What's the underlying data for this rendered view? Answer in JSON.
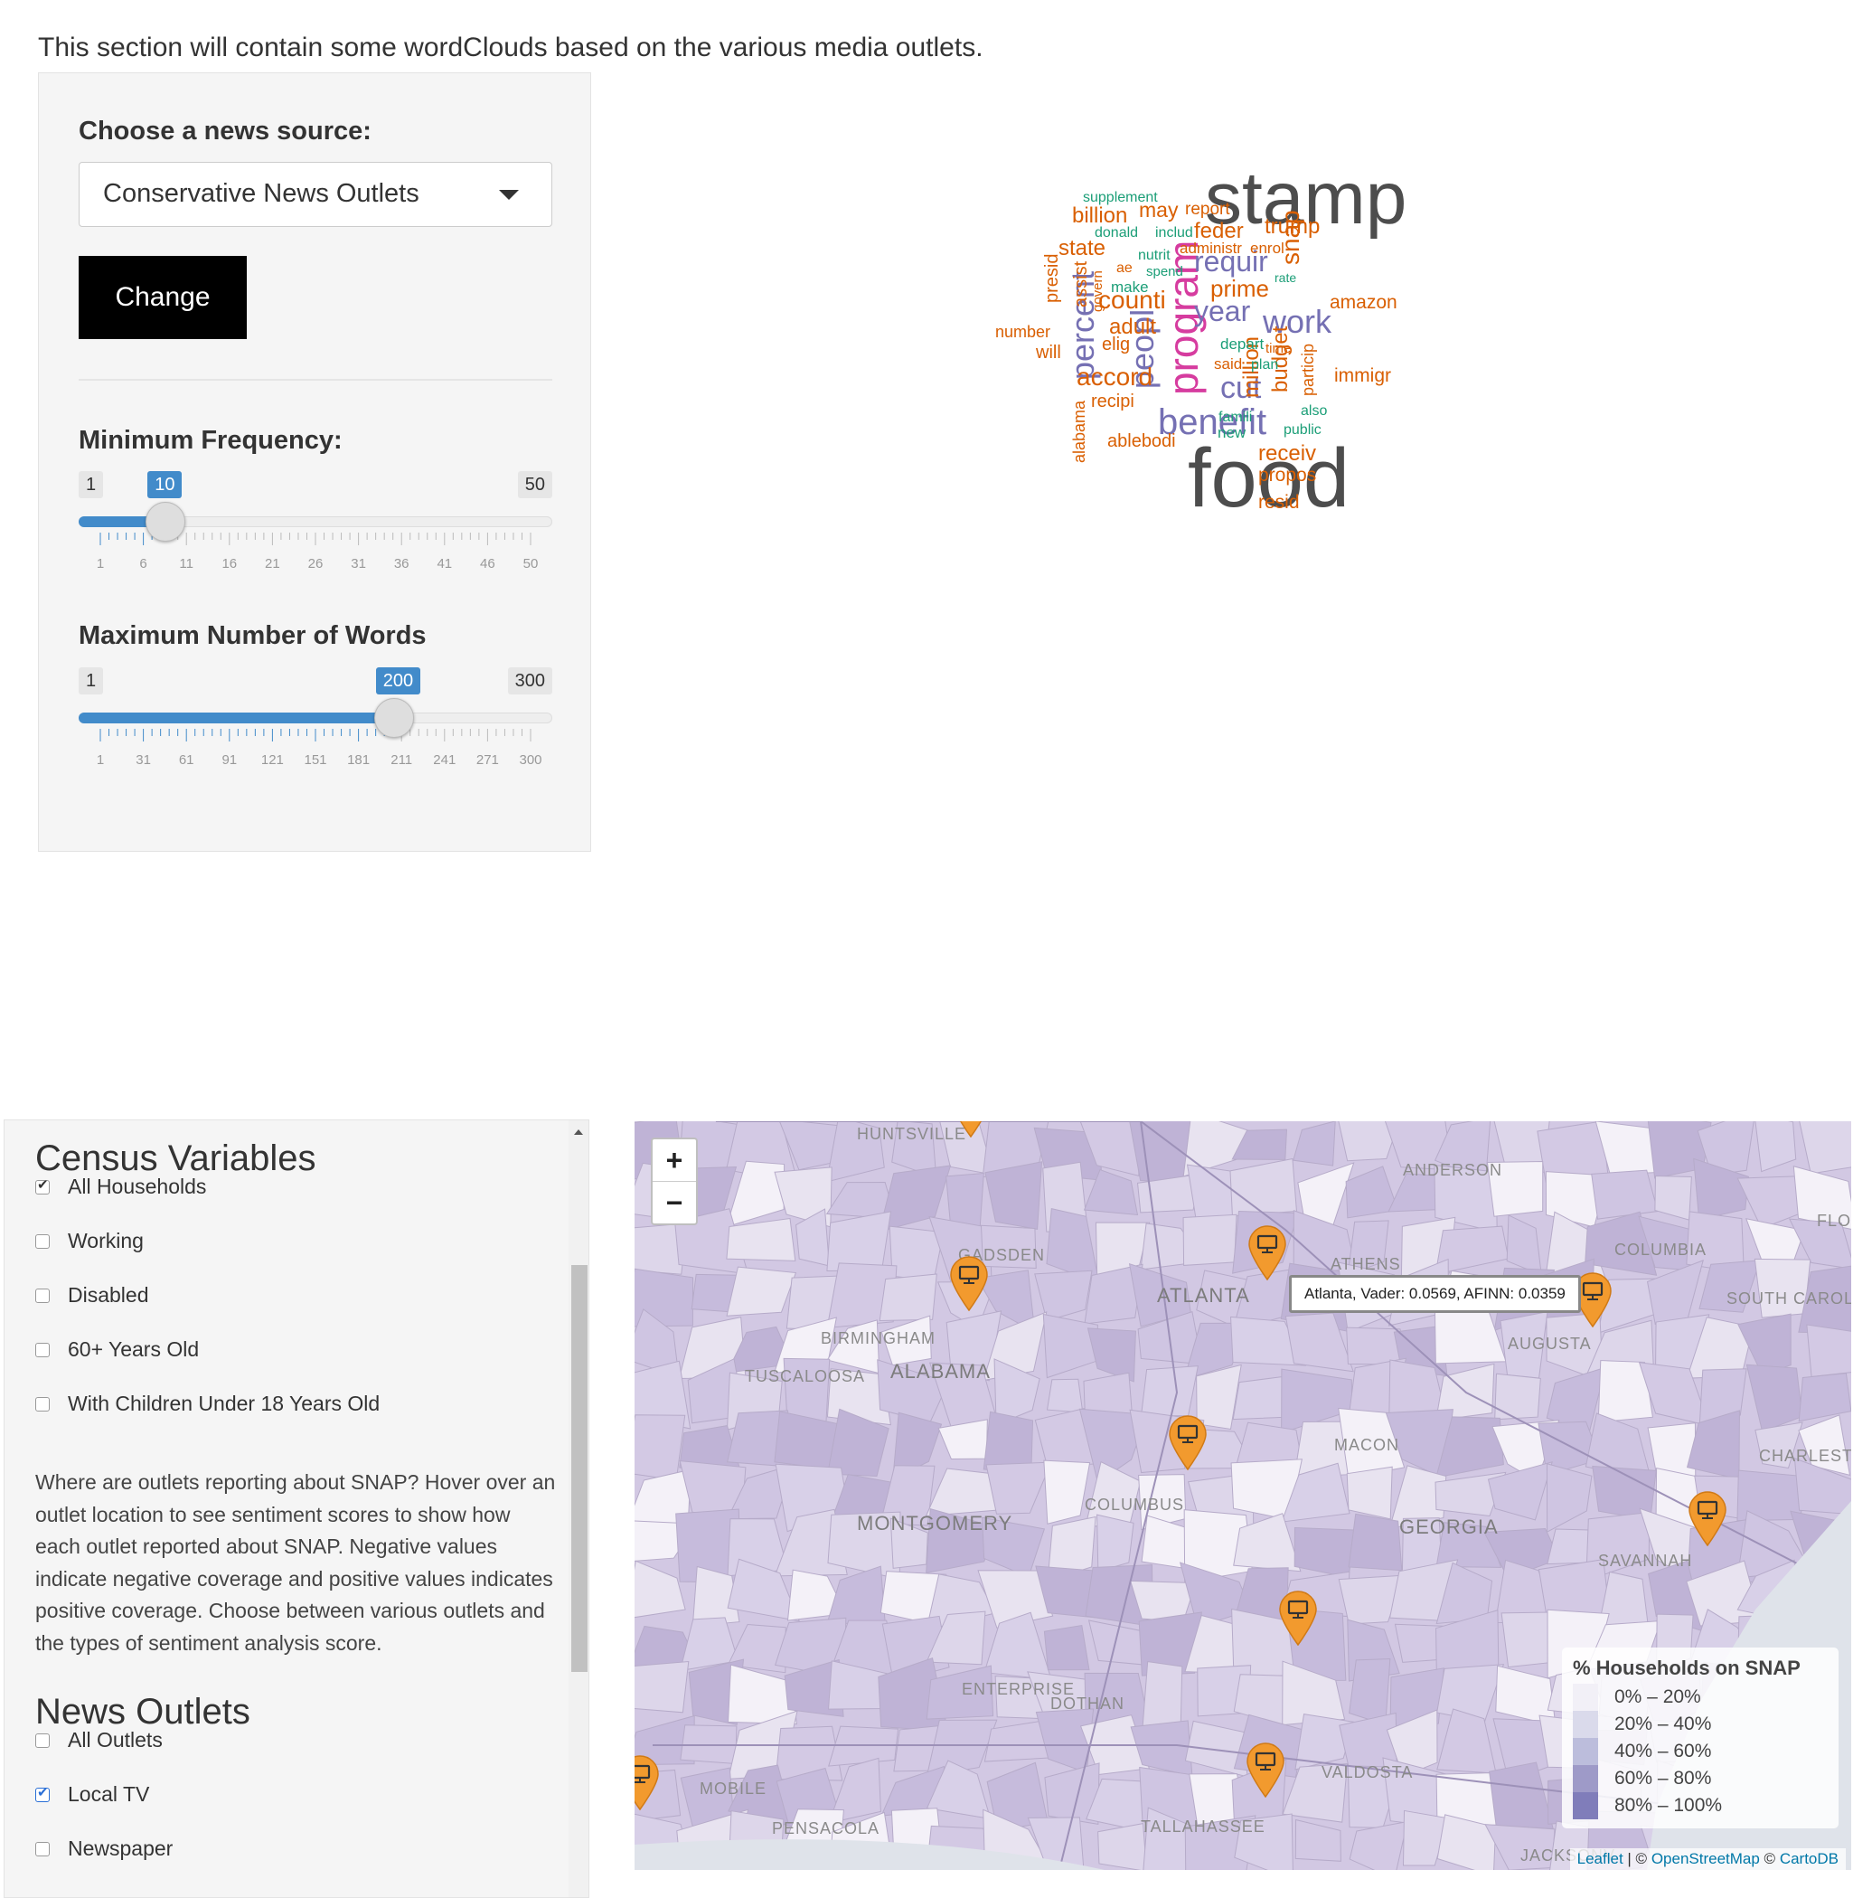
{
  "intro": "This section will contain some wordClouds based on the various media outlets.",
  "wordcloud_panel": {
    "source_label": "Choose a news source:",
    "source_value": "Conservative News Outlets",
    "change_button": "Change",
    "min_freq": {
      "label": "Minimum Frequency:",
      "min": "1",
      "max": "50",
      "value": "10",
      "value_num": 10,
      "range": [
        1,
        50
      ],
      "grid": [
        "1",
        "6",
        "11",
        "16",
        "21",
        "26",
        "31",
        "36",
        "41",
        "46",
        "50"
      ]
    },
    "max_words": {
      "label": "Maximum Number of Words",
      "min": "1",
      "max": "300",
      "value": "200",
      "value_num": 200,
      "range": [
        1,
        300
      ],
      "grid": [
        "1",
        "31",
        "61",
        "91",
        "121",
        "151",
        "181",
        "211",
        "241",
        "271",
        "300"
      ]
    }
  },
  "wordcloud": {
    "words": [
      {
        "text": "stamp",
        "color": "#4d4d4d"
      },
      {
        "text": "food",
        "color": "#4d4d4d"
      },
      {
        "text": "program",
        "color": "#d63c9f"
      },
      {
        "text": "benefit",
        "color": "#7570b3"
      },
      {
        "text": "percent",
        "color": "#7570b3"
      },
      {
        "text": "peopl",
        "color": "#7570b3"
      },
      {
        "text": "work",
        "color": "#7570b3"
      },
      {
        "text": "year",
        "color": "#7570b3"
      },
      {
        "text": "cut",
        "color": "#7570b3"
      },
      {
        "text": "requir",
        "color": "#7570b3"
      },
      {
        "text": "snap",
        "color": "#d95f02"
      },
      {
        "text": "accord",
        "color": "#d95f02"
      },
      {
        "text": "counti",
        "color": "#d95f02"
      },
      {
        "text": "prime",
        "color": "#d95f02"
      },
      {
        "text": "adult",
        "color": "#d95f02"
      },
      {
        "text": "trump",
        "color": "#d95f02"
      },
      {
        "text": "feder",
        "color": "#d95f02"
      },
      {
        "text": "billion",
        "color": "#d95f02"
      },
      {
        "text": "state",
        "color": "#d95f02"
      },
      {
        "text": "may",
        "color": "#d95f02"
      },
      {
        "text": "report",
        "color": "#d95f02"
      },
      {
        "text": "amazon",
        "color": "#d95f02"
      },
      {
        "text": "immigr",
        "color": "#d95f02"
      },
      {
        "text": "million",
        "color": "#d95f02"
      },
      {
        "text": "budget",
        "color": "#d95f02"
      },
      {
        "text": "receiv",
        "color": "#d95f02"
      },
      {
        "text": "propos",
        "color": "#d95f02"
      },
      {
        "text": "resid",
        "color": "#d95f02"
      },
      {
        "text": "ablebodi",
        "color": "#d95f02"
      },
      {
        "text": "recipi",
        "color": "#d95f02"
      },
      {
        "text": "elig",
        "color": "#d95f02"
      },
      {
        "text": "will",
        "color": "#d95f02"
      },
      {
        "text": "number",
        "color": "#d95f02"
      },
      {
        "text": "presid",
        "color": "#d95f02"
      },
      {
        "text": "assist",
        "color": "#d95f02"
      },
      {
        "text": "alabama",
        "color": "#d95f02"
      },
      {
        "text": "particip",
        "color": "#d95f02"
      },
      {
        "text": "administr",
        "color": "#d95f02"
      },
      {
        "text": "enrol",
        "color": "#d95f02"
      },
      {
        "text": "said",
        "color": "#d95f02"
      },
      {
        "text": "supplement",
        "color": "#1b9e77"
      },
      {
        "text": "donald",
        "color": "#1b9e77"
      },
      {
        "text": "includ",
        "color": "#1b9e77"
      },
      {
        "text": "nutrit",
        "color": "#1b9e77"
      },
      {
        "text": "spend",
        "color": "#1b9e77"
      },
      {
        "text": "make",
        "color": "#1b9e77"
      },
      {
        "text": "depart",
        "color": "#1b9e77"
      },
      {
        "text": "time",
        "color": "#d95f02"
      },
      {
        "text": "plan",
        "color": "#1b9e77"
      },
      {
        "text": "also",
        "color": "#1b9e77"
      },
      {
        "text": "public",
        "color": "#1b9e77"
      },
      {
        "text": "famili",
        "color": "#1b9e77"
      },
      {
        "text": "new",
        "color": "#1b9e77"
      },
      {
        "text": "rate",
        "color": "#1b9e77"
      },
      {
        "text": "govern",
        "color": "#d95f02"
      },
      {
        "text": "ae",
        "color": "#d95f02"
      }
    ]
  },
  "census": {
    "title": "Census Variables",
    "vars": [
      {
        "label": "All Households",
        "checked": true
      },
      {
        "label": "Working",
        "checked": false
      },
      {
        "label": "Disabled",
        "checked": false
      },
      {
        "label": "60+ Years Old",
        "checked": false
      },
      {
        "label": "With Children Under 18 Years Old",
        "checked": false
      }
    ],
    "description": "Where are outlets reporting about SNAP? Hover over an outlet location to see sentiment scores to show how each outlet reported about SNAP. Negative values indicate negative coverage and positive values indicates positive coverage. Choose between various outlets and the types of sentiment analysis score.",
    "outlets_title": "News Outlets",
    "outlets": [
      {
        "label": "All Outlets",
        "checked": false
      },
      {
        "label": "Local TV",
        "checked": true
      },
      {
        "label": "Newspaper",
        "checked": false
      }
    ]
  },
  "map": {
    "zoom_in": "+",
    "zoom_out": "−",
    "tooltip": "Atlanta, Vader: 0.0569, AFINN: 0.0359",
    "legend_title": "% Households on SNAP",
    "legend": [
      {
        "label": "0% – 20%",
        "color": "#f2f0f7"
      },
      {
        "label": "20% – 40%",
        "color": "#dadaeb"
      },
      {
        "label": "40% – 60%",
        "color": "#bcbddc"
      },
      {
        "label": "60% – 80%",
        "color": "#9e9ac8"
      },
      {
        "label": "80% – 100%",
        "color": "#807dba"
      }
    ],
    "attribution": {
      "leaflet": "Leaflet",
      "sep": " | © ",
      "osm": "OpenStreetMap",
      "sep2": " © ",
      "carto": "CartoDB"
    },
    "places": [
      "HUNTSVILLE",
      "ANDERSON",
      "GADSDEN",
      "ATHENS",
      "COLUMBIA",
      "FLOR",
      "ATLANTA",
      "SOUTH CAROL",
      "BIRMINGHAM",
      "AUGUSTA",
      "TUSCALOOSA",
      "ALABAMA",
      "MACON",
      "CHARLESTO",
      "COLUMBUS",
      "MONTGOMERY",
      "GEORGIA",
      "SAVANNAH",
      "ENTERPRISE",
      "DOTHAN",
      "VALDOSTA",
      "MOBILE",
      "PENSACOLA",
      "TALLAHASSEE",
      "JACKSONV"
    ],
    "marker_color": "#f29a2e"
  }
}
